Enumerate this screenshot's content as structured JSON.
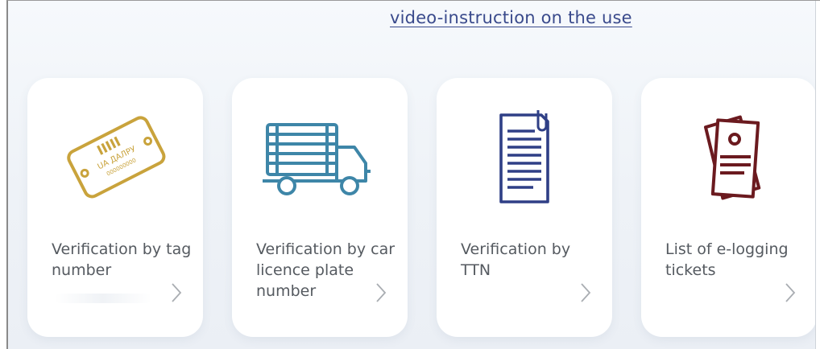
{
  "header": {
    "video_link": "video-instruction on the use"
  },
  "cards": [
    {
      "label": "Verification by tag number",
      "icon": "tag-icon",
      "color": "#C9A33C"
    },
    {
      "label": "Verification by car licence plate number",
      "icon": "truck-icon",
      "color": "#3E86A8"
    },
    {
      "label": "Verification by TTN",
      "icon": "document-icon",
      "color": "#2F3F86"
    },
    {
      "label": "List of e-logging tickets",
      "icon": "tickets-list-icon",
      "color": "#6B1A1F"
    }
  ],
  "tag_text": {
    "line1": "UA ДАЛРУ",
    "line2": "000000000"
  }
}
